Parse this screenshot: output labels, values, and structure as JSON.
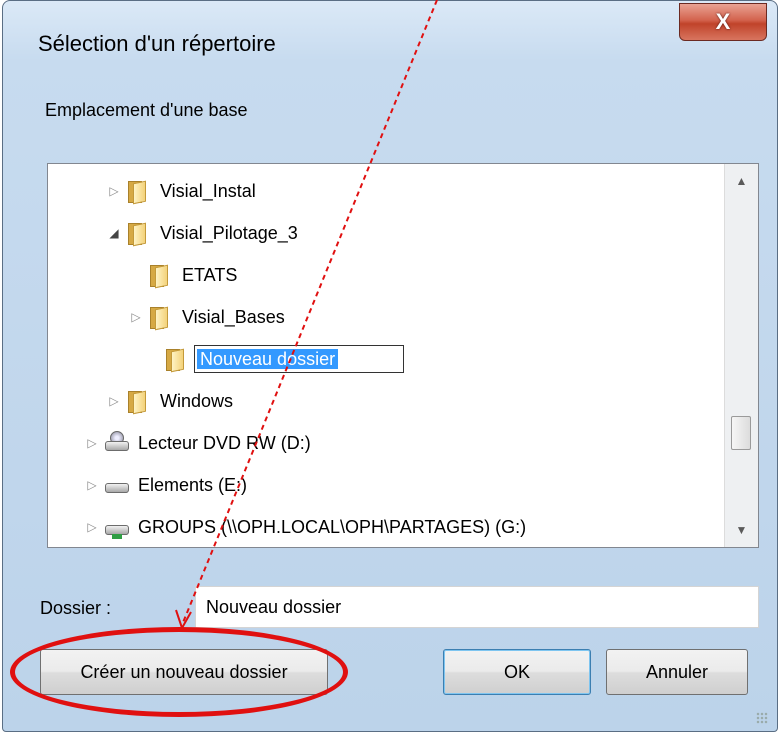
{
  "window": {
    "title": "Sélection d'un répertoire",
    "close_glyph": "X"
  },
  "caption": "Emplacement d'une base",
  "tree": {
    "items": [
      {
        "label": "Visial_Instal",
        "icon": "folder-icon",
        "expander": "collapsed"
      },
      {
        "label": "Visial_Pilotage_3",
        "icon": "folder-icon",
        "expander": "expanded"
      },
      {
        "label": "ETATS",
        "icon": "folder-icon",
        "expander": "none"
      },
      {
        "label": "Visial_Bases",
        "icon": "folder-icon",
        "expander": "collapsed"
      },
      {
        "label": "Nouveau dossier",
        "icon": "folder-icon",
        "expander": "none",
        "editing": true
      },
      {
        "label": "Windows",
        "icon": "folder-icon",
        "expander": "collapsed"
      },
      {
        "label": "Lecteur DVD RW (D:)",
        "icon": "dvd-drive-icon",
        "expander": "collapsed"
      },
      {
        "label": "Elements (E:)",
        "icon": "removable-drive-icon",
        "expander": "collapsed"
      },
      {
        "label": "GROUPS (\\\\OPH.LOCAL\\OPH\\PARTAGES) (G:)",
        "icon": "network-drive-icon",
        "expander": "collapsed"
      }
    ]
  },
  "folder_field": {
    "label": "Dossier :",
    "value": "Nouveau dossier"
  },
  "buttons": {
    "create_folder": "Créer un nouveau dossier",
    "ok": "OK",
    "cancel": "Annuler"
  },
  "colors": {
    "selection": "#3399ff",
    "annotation": "#e01010"
  }
}
